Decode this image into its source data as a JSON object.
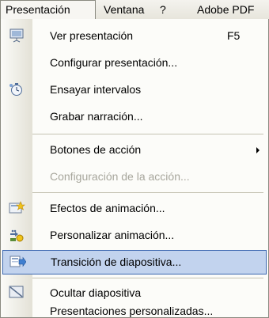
{
  "menubar": {
    "items": [
      {
        "label": "Presentación",
        "active": true
      },
      {
        "label": "Ventana"
      },
      {
        "label": "?"
      },
      {
        "label": "Adobe PDF"
      }
    ]
  },
  "menu": {
    "items": [
      {
        "label": "Ver presentación",
        "shortcut": "F5",
        "icon": "slideshow-icon"
      },
      {
        "label": "Configurar presentación...",
        "icon": null
      },
      {
        "label": "Ensayar intervalos",
        "icon": "rehearse-timings-icon"
      },
      {
        "label": "Grabar narración...",
        "icon": null
      },
      {
        "label": "Botones de acción",
        "icon": null,
        "submenu": true
      },
      {
        "label": "Configuración de la acción...",
        "icon": null,
        "disabled": true
      },
      {
        "label": "Efectos de animación...",
        "icon": "animation-effects-icon"
      },
      {
        "label": "Personalizar animación...",
        "icon": "custom-animation-icon"
      },
      {
        "label": "Transición de diapositiva...",
        "icon": "slide-transition-icon",
        "highlighted": true
      },
      {
        "label": "Ocultar diapositiva",
        "icon": "hide-slide-icon"
      },
      {
        "label": "Presentaciones personalizadas...",
        "icon": null
      }
    ]
  },
  "colors": {
    "highlight_fill": "#c2d3ee",
    "highlight_border": "#3d68b0",
    "disabled_text": "#a7a69c"
  }
}
